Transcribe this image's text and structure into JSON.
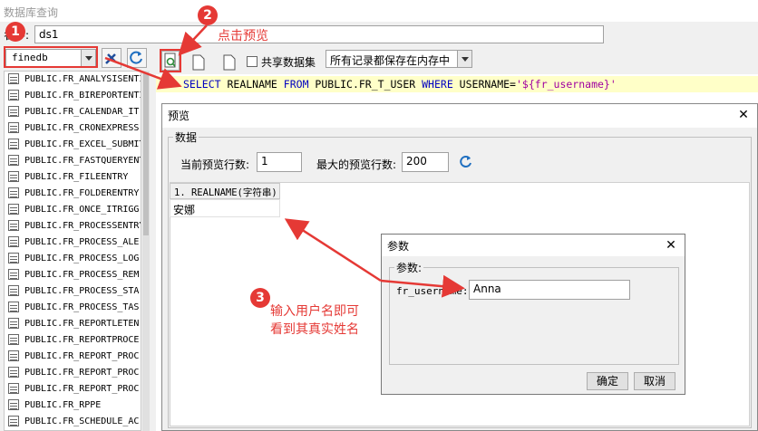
{
  "window": {
    "title": "数据库查询"
  },
  "query": {
    "name_label": "名字:",
    "name_value": "ds1"
  },
  "database": {
    "selected": "finedb"
  },
  "toolbar": {
    "share_label": "共享数据集",
    "mode_selected": "所有记录都保存在内存中"
  },
  "sql": {
    "line_no": "1",
    "select_kw": "SELECT",
    "cols": " REALNAME ",
    "from_kw": "FROM",
    "table": " PUBLIC.FR_T_USER ",
    "where_kw": "WHERE",
    "cond": " USERNAME=",
    "param": "'${fr_username}'"
  },
  "tables": [
    "PUBLIC.FR_ANALYSISENTI",
    "PUBLIC.FR_BIREPORTENTI",
    "PUBLIC.FR_CALENDAR_IT",
    "PUBLIC.FR_CRONEXPRESS",
    "PUBLIC.FR_EXCEL_SUBMIT",
    "PUBLIC.FR_FASTQUERYENT",
    "PUBLIC.FR_FILEENTRY",
    "PUBLIC.FR_FOLDERENTRY",
    "PUBLIC.FR_ONCE_ITRIGG",
    "PUBLIC.FR_PROCESSENTRY",
    "PUBLIC.FR_PROCESS_ALE",
    "PUBLIC.FR_PROCESS_LOG",
    "PUBLIC.FR_PROCESS_REM",
    "PUBLIC.FR_PROCESS_STA",
    "PUBLIC.FR_PROCESS_TAS",
    "PUBLIC.FR_REPORTLETEN",
    "PUBLIC.FR_REPORTPROCE",
    "PUBLIC.FR_REPORT_PROC",
    "PUBLIC.FR_REPORT_PROC",
    "PUBLIC.FR_REPORT_PROC",
    "PUBLIC.FR_RPPE",
    "PUBLIC.FR_SCHEDULE_AC"
  ],
  "preview": {
    "title": "预览",
    "group_label": "数据",
    "current_rows_label": "当前预览行数:",
    "current_rows_value": "1",
    "max_rows_label": "最大的预览行数:",
    "max_rows_value": "200",
    "column_header": "1. REALNAME(字符串)",
    "cell_value": "安娜"
  },
  "param_dialog": {
    "title": "参数",
    "group_label": "参数:",
    "field_label": "fr_username:",
    "field_value": "Anna",
    "ok_label": "确定",
    "cancel_label": "取消"
  },
  "annotations": {
    "n1": "1",
    "n2": "2",
    "n3": "3",
    "text2": "点击预览",
    "text3_line1": "输入用户名即可",
    "text3_line2": "看到其真实姓名"
  },
  "colors": {
    "accent_red": "#e53935",
    "sql_highlight": "#ffffc8",
    "keyword": "#0000c0"
  }
}
